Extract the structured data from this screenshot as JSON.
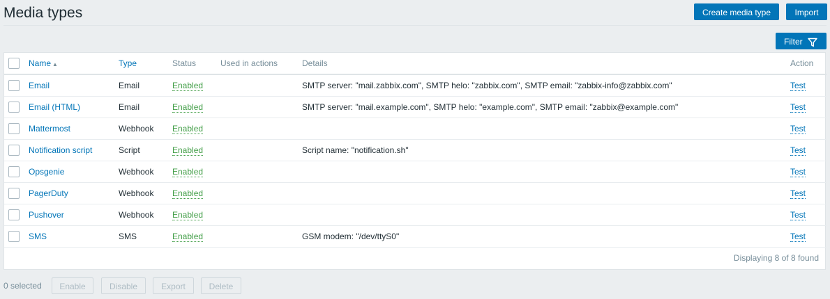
{
  "page": {
    "title": "Media types"
  },
  "header": {
    "create_label": "Create media type",
    "import_label": "Import",
    "filter_label": "Filter"
  },
  "table": {
    "columns": [
      "Name",
      "Type",
      "Status",
      "Used in actions",
      "Details",
      "Action"
    ],
    "sort": {
      "column": "Name",
      "direction": "asc"
    },
    "rows": [
      {
        "name": "Email",
        "type": "Email",
        "status": "Enabled",
        "used": "",
        "details": "SMTP server: \"mail.zabbix.com\", SMTP helo: \"zabbix.com\", SMTP email: \"zabbix-info@zabbix.com\"",
        "action": "Test"
      },
      {
        "name": "Email (HTML)",
        "type": "Email",
        "status": "Enabled",
        "used": "",
        "details": "SMTP server: \"mail.example.com\", SMTP helo: \"example.com\", SMTP email: \"zabbix@example.com\"",
        "action": "Test"
      },
      {
        "name": "Mattermost",
        "type": "Webhook",
        "status": "Enabled",
        "used": "",
        "details": "",
        "action": "Test"
      },
      {
        "name": "Notification script",
        "type": "Script",
        "status": "Enabled",
        "used": "",
        "details": "Script name: \"notification.sh\"",
        "action": "Test"
      },
      {
        "name": "Opsgenie",
        "type": "Webhook",
        "status": "Enabled",
        "used": "",
        "details": "",
        "action": "Test"
      },
      {
        "name": "PagerDuty",
        "type": "Webhook",
        "status": "Enabled",
        "used": "",
        "details": "",
        "action": "Test"
      },
      {
        "name": "Pushover",
        "type": "Webhook",
        "status": "Enabled",
        "used": "",
        "details": "",
        "action": "Test"
      },
      {
        "name": "SMS",
        "type": "SMS",
        "status": "Enabled",
        "used": "",
        "details": "GSM modem: \"/dev/ttyS0\"",
        "action": "Test"
      }
    ],
    "found_text": "Displaying 8 of 8 found"
  },
  "footer": {
    "selected_text": "0 selected",
    "enable_label": "Enable",
    "disable_label": "Disable",
    "export_label": "Export",
    "delete_label": "Delete"
  },
  "colors": {
    "accent": "#0275b8",
    "status_enabled": "#429e47",
    "background": "#ebeef0",
    "header_text": "#768d99"
  },
  "icons": {
    "filter": "funnel-icon",
    "sort": "sort-asc-icon"
  }
}
